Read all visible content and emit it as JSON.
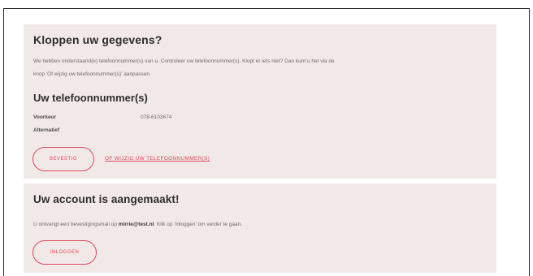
{
  "confirm": {
    "title": "Kloppen uw gegevens?",
    "intro_line1": "We hebben onderstaand(e) telefoonnummer(s) van u. Controleer uw telefoonnummer(s). Klopt er iets niet? Dan kunt u het via de",
    "intro_line2": "knop 'Of wijzig uw telefoonnummer(s)' aanpassen.",
    "phones_heading": "Uw telefoonnummer(s)",
    "primary_label": "Voorkeur",
    "primary_value": "078-6103674",
    "alternative_label": "Alternatief",
    "alternative_value": "",
    "confirm_button": "BEVESTIG",
    "change_link": "OF WIJZIG UW TELEFOONNUMMER(S)"
  },
  "account": {
    "title": "Uw account is aangemaakt!",
    "message_prefix": "U ontvangt een bevestigingsmail op ",
    "email": "mirrie@test.nl",
    "message_suffix": ". Klik op 'Inloggen' om verder te gaan.",
    "login_button": "INLOGGEN"
  },
  "colors": {
    "accent": "#e04660",
    "panel_background": "#f1e9e7"
  }
}
